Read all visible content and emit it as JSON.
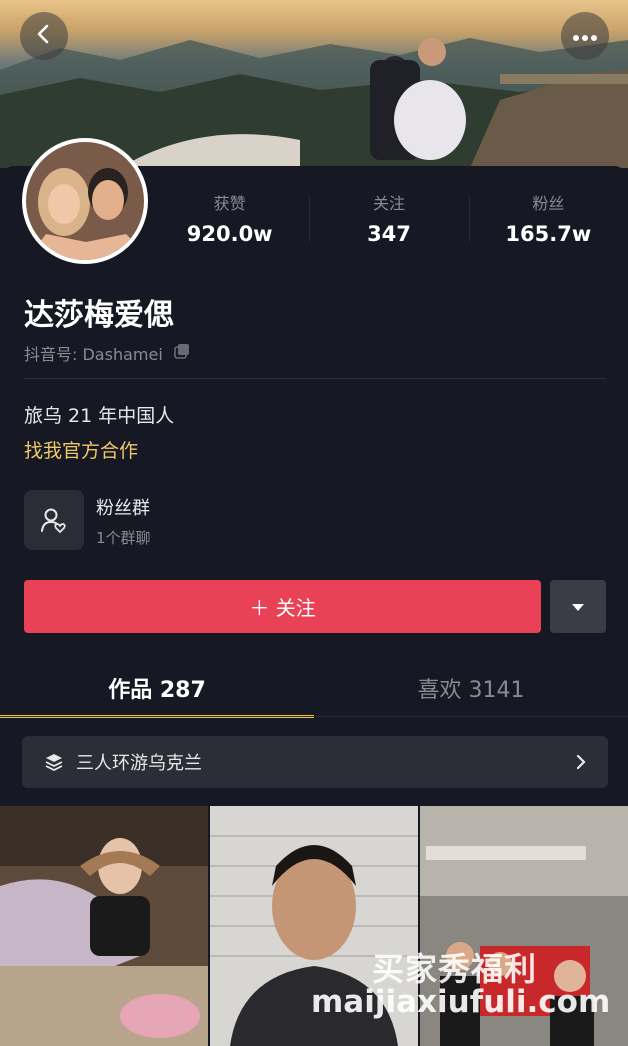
{
  "header": {
    "back_icon": "chevron-left-icon",
    "more_icon": "more-horizontal-icon"
  },
  "profile": {
    "name": "达莎梅爱偲",
    "handle": "抖音号: Dashamei",
    "bio": "旅乌 21 年中国人",
    "cooperation_link": "找我官方合作"
  },
  "stats": [
    {
      "label": "获赞",
      "value": "920.0w"
    },
    {
      "label": "关注",
      "value": "347"
    },
    {
      "label": "粉丝",
      "value": "165.7w"
    }
  ],
  "fan_group": {
    "title": "粉丝群",
    "subtitle": "1个群聊"
  },
  "actions": {
    "follow_label": "＋ 关注"
  },
  "tabs": [
    {
      "label": "作品 287"
    },
    {
      "label": "喜欢 3141"
    }
  ],
  "collection": {
    "label": "三人环游乌克兰"
  },
  "watermark": {
    "line1": "买家秀福利",
    "line2": "maijiaxiufuli.com"
  },
  "colors": {
    "accent": "#e94256",
    "tab_indicator": "#f0c43a",
    "link": "#f0c86a",
    "background": "#161823"
  }
}
